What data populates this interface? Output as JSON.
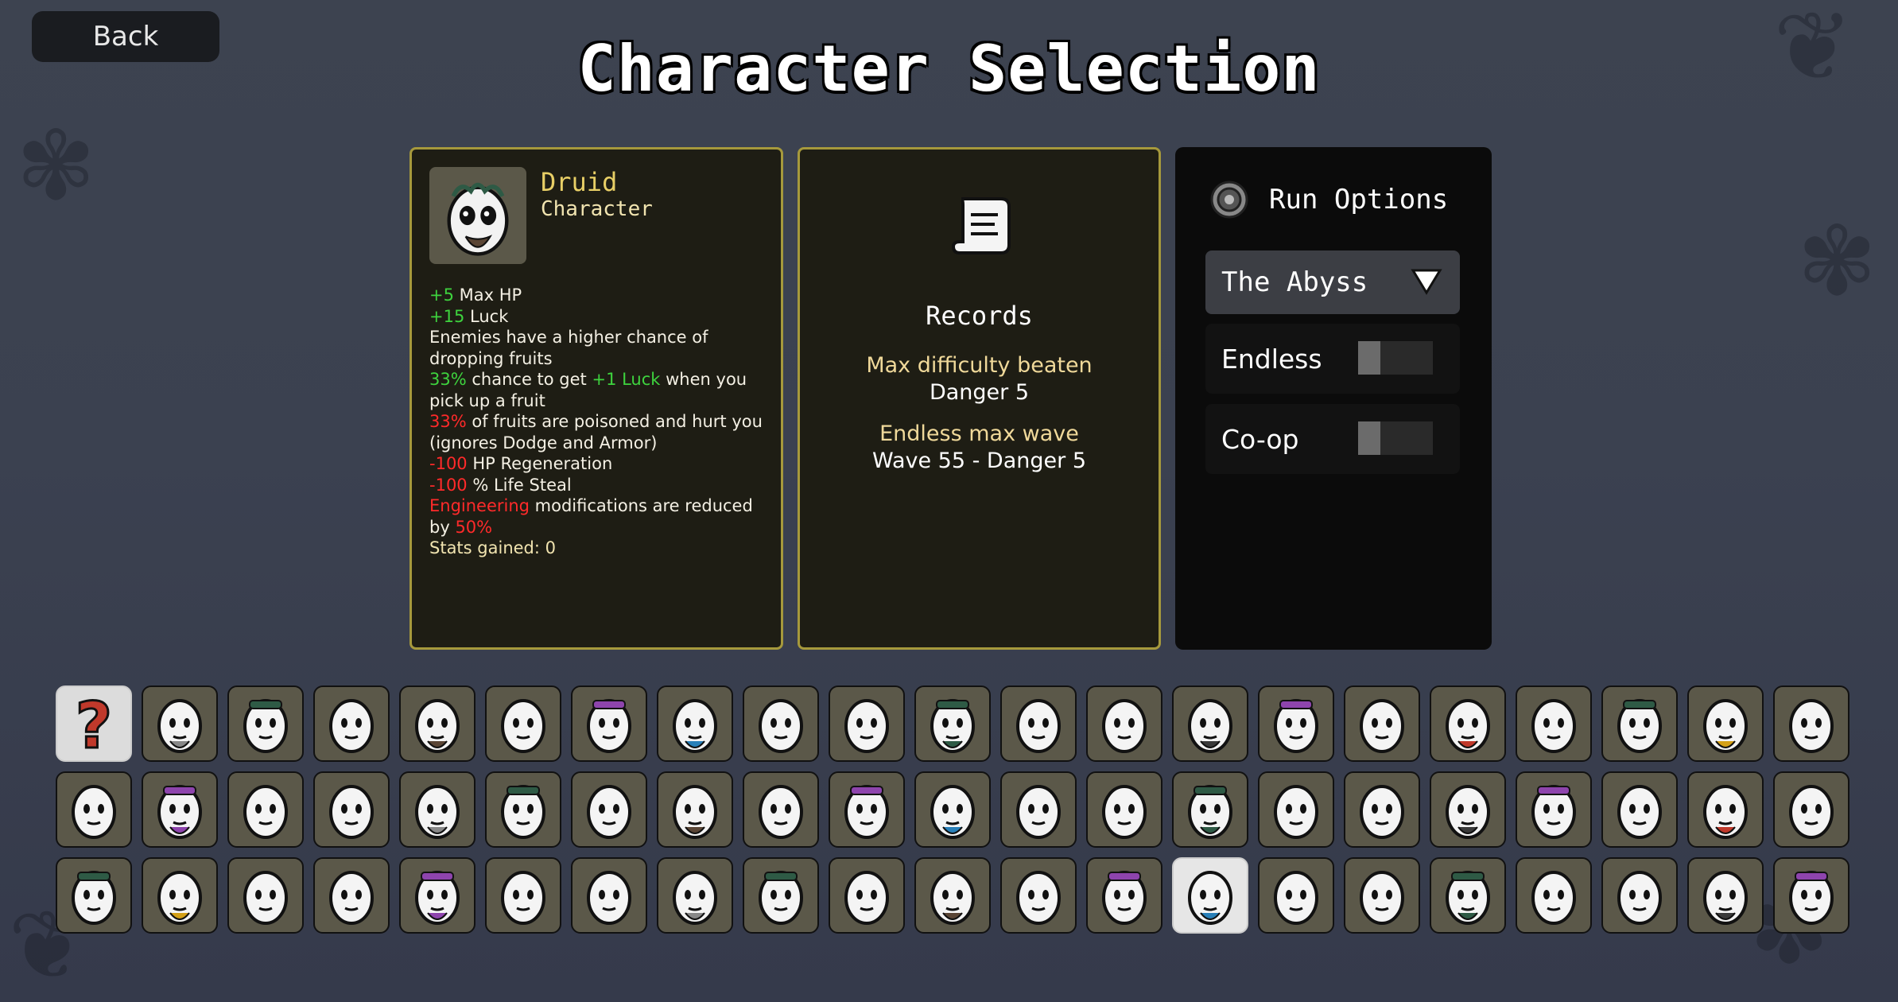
{
  "back_label": "Back",
  "title": "Character Selection",
  "character": {
    "name": "Druid",
    "type": "Character",
    "description_lines": [
      [
        [
          "+5",
          "g"
        ],
        [
          " Max HP",
          ""
        ]
      ],
      [
        [
          "+15",
          "g"
        ],
        [
          " Luck",
          ""
        ]
      ],
      [
        [
          "Enemies have a higher chance of dropping fruits",
          ""
        ]
      ],
      [
        [
          "33%",
          "g"
        ],
        [
          " chance to get ",
          ""
        ],
        [
          "+1 Luck",
          "g"
        ],
        [
          " when you pick up a fruit",
          ""
        ]
      ],
      [
        [
          "33%",
          "r"
        ],
        [
          " of fruits are poisoned and hurt you (ignores Dodge and Armor)",
          ""
        ]
      ],
      [
        [
          "-100",
          "r"
        ],
        [
          " HP Regeneration",
          ""
        ]
      ],
      [
        [
          "-100",
          "r"
        ],
        [
          " % Life Steal",
          ""
        ]
      ],
      [
        [
          "Engineering",
          "r"
        ],
        [
          " modifications are reduced by ",
          ""
        ],
        [
          "50%",
          "r"
        ]
      ],
      [
        [
          "Stats gained: 0",
          "y"
        ]
      ]
    ]
  },
  "records": {
    "title": "Records",
    "max_difficulty_label": "Max difficulty beaten",
    "max_difficulty_value": "Danger 5",
    "endless_label": "Endless max wave",
    "endless_value": "Wave 55 - Danger 5"
  },
  "run_options": {
    "title": "Run Options",
    "zone": "The Abyss",
    "endless_label": "Endless",
    "endless_on": false,
    "coop_label": "Co-op",
    "coop_on": false
  },
  "roster": {
    "columns": 21,
    "rows": 3,
    "random_index": 0,
    "selected_index": 55
  }
}
